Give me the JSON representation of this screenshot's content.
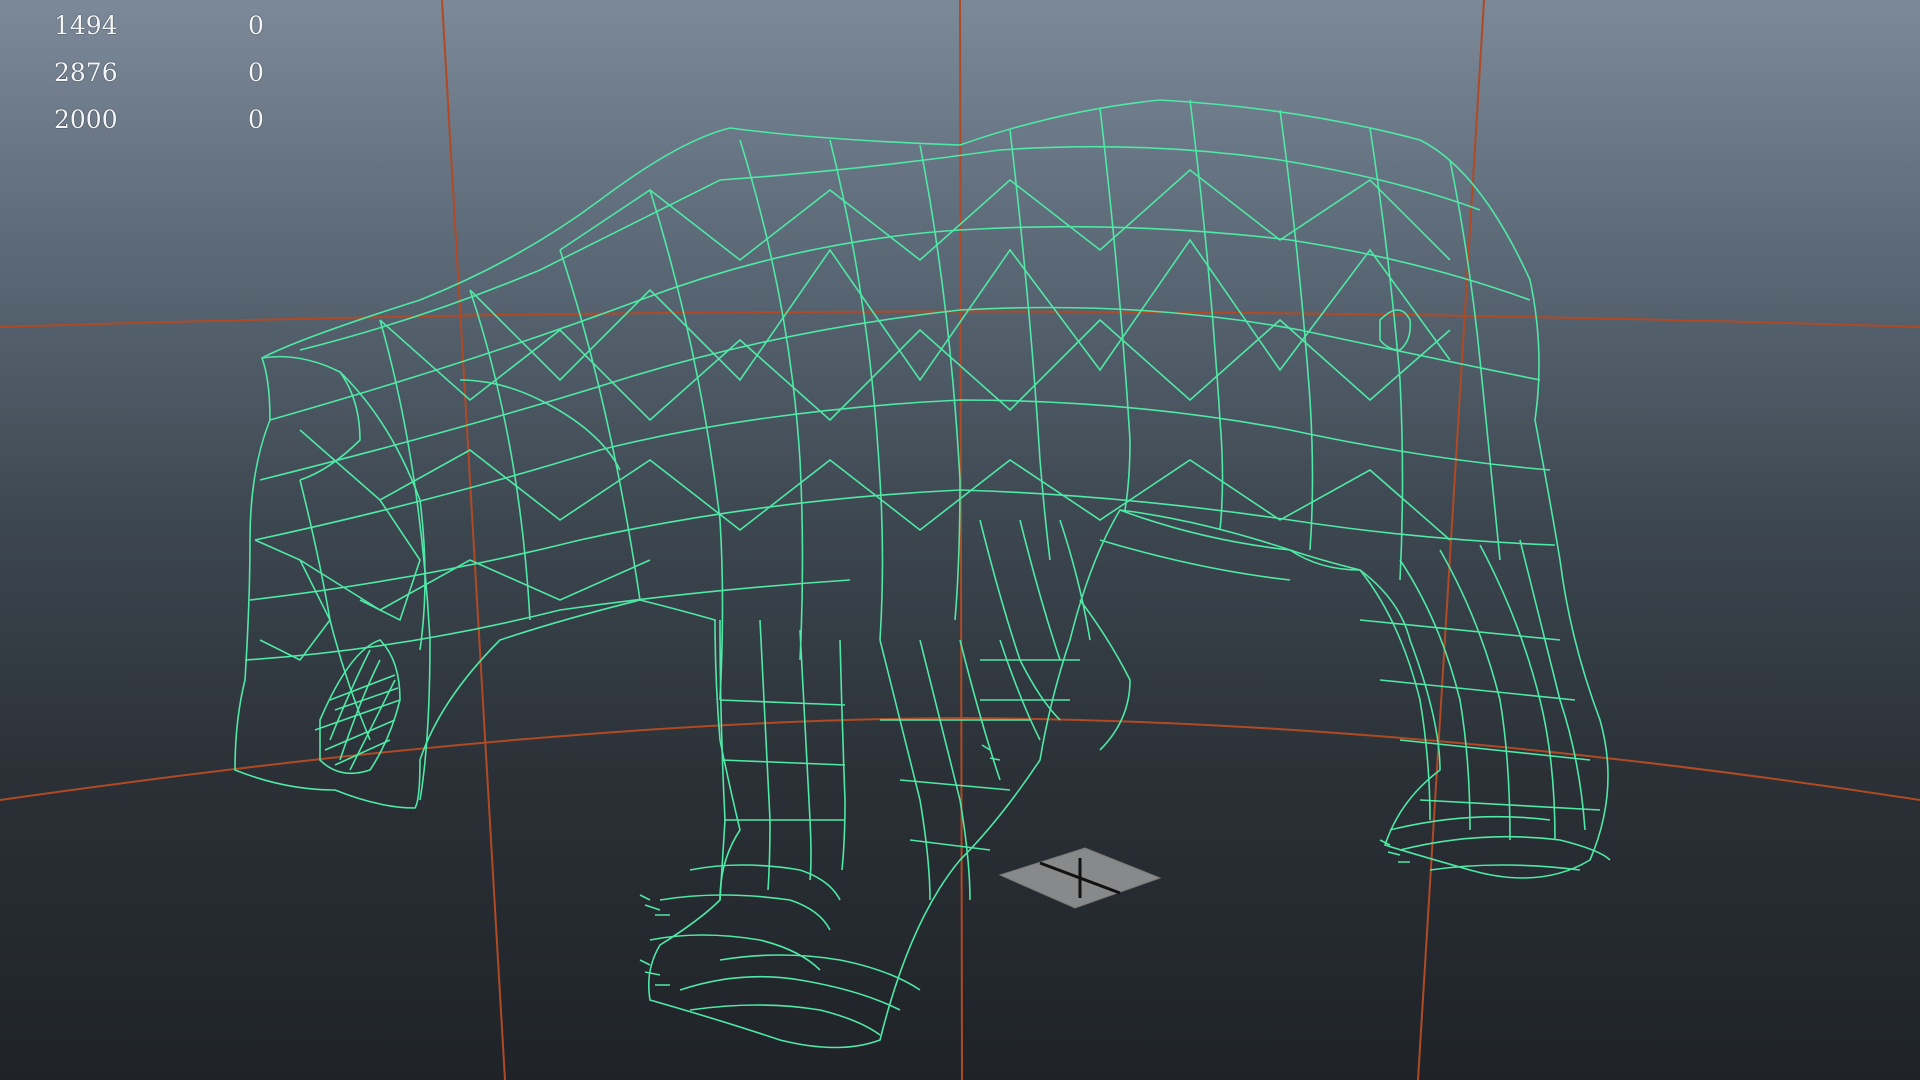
{
  "viewport": {
    "background_top": "#7b8999",
    "background_bottom": "#1f2328",
    "grid_color": "#b04a25",
    "wireframe_color": "#4fe8a6",
    "manipulator_color": "#9a9a9a"
  },
  "heads_up_display": {
    "rows": [
      {
        "count": "1494",
        "selected": "0"
      },
      {
        "count": "2876",
        "selected": "0"
      },
      {
        "count": "2000",
        "selected": "0"
      }
    ]
  },
  "icons": {
    "origin_manipulator": "move-manipulator-icon"
  }
}
